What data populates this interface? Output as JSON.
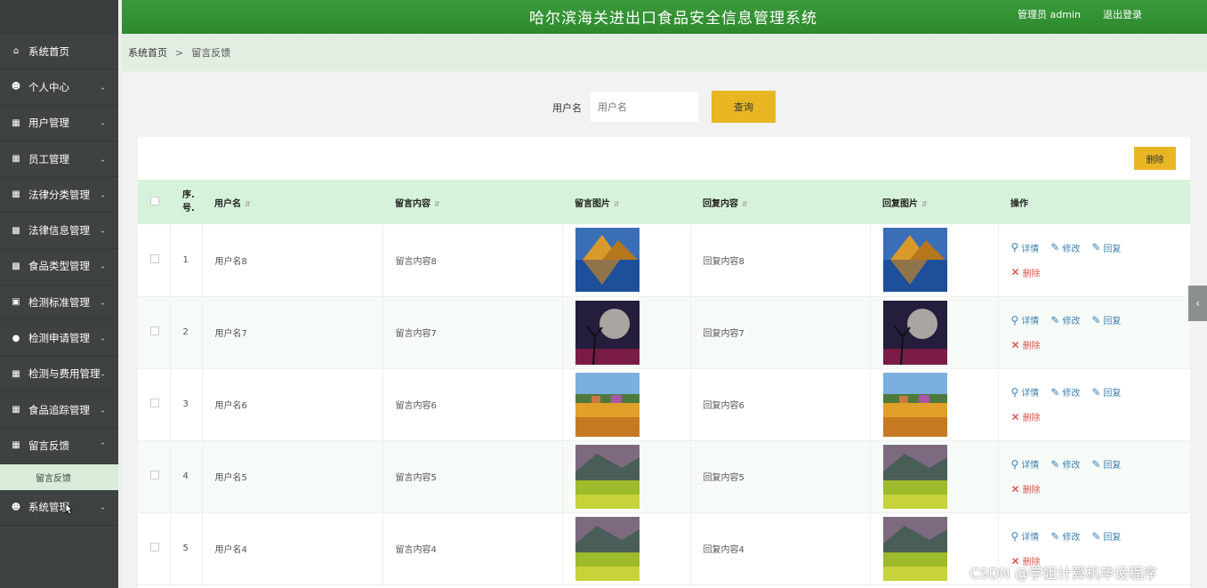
{
  "header": {
    "title": "哈尔滨海关进出口食品安全信息管理系统",
    "user": "管理员 admin",
    "logout": "退出登录"
  },
  "sidebar": {
    "items": [
      {
        "label": "系统首页",
        "icon": "home-icon"
      },
      {
        "label": "个人中心",
        "icon": "person-icon"
      },
      {
        "label": "用户管理",
        "icon": "table-icon"
      },
      {
        "label": "员工管理",
        "icon": "grid-icon"
      },
      {
        "label": "法律分类管理",
        "icon": "grid-icon"
      },
      {
        "label": "法律信息管理",
        "icon": "clipboard-icon"
      },
      {
        "label": "食品类型管理",
        "icon": "clipboard-icon"
      },
      {
        "label": "检测标准管理",
        "icon": "briefcase-icon"
      },
      {
        "label": "检测申请管理",
        "icon": "pin-icon"
      },
      {
        "label": "检测与费用管理",
        "icon": "grid-icon"
      },
      {
        "label": "食品追踪管理",
        "icon": "grid-icon"
      },
      {
        "label": "留言反馈",
        "icon": "grid-icon"
      }
    ],
    "subitem": "留言反馈",
    "last": {
      "label": "系统管理",
      "icon": "person-icon"
    }
  },
  "breadcrumb": {
    "home": "系统首页",
    "sep": ">",
    "current": "留言反馈"
  },
  "search": {
    "label": "用户名",
    "placeholder": "用户名",
    "button": "查询"
  },
  "toolbar": {
    "delete": "删除"
  },
  "table": {
    "headers": {
      "index": "序.号.",
      "username": "用户名",
      "content": "留言内容",
      "image": "留言图片",
      "reply": "回复内容",
      "reply_image": "回复图片",
      "actions": "操作"
    },
    "rows": [
      {
        "index": "1",
        "username": "用户名8",
        "content": "留言内容8",
        "reply": "回复内容8",
        "scene": "lake"
      },
      {
        "index": "2",
        "username": "用户名7",
        "content": "留言内容7",
        "reply": "回复内容7",
        "scene": "moon"
      },
      {
        "index": "3",
        "username": "用户名6",
        "content": "留言内容6",
        "reply": "回复内容6",
        "scene": "field"
      },
      {
        "index": "4",
        "username": "用户名5",
        "content": "留言内容5",
        "reply": "回复内容5",
        "scene": "meadow"
      },
      {
        "index": "5",
        "username": "用户名4",
        "content": "留言内容4",
        "reply": "回复内容4",
        "scene": "meadow"
      }
    ],
    "actions": {
      "detail": "详情",
      "edit": "修改",
      "reply": "回复",
      "delete": "删除"
    }
  },
  "watermark": "CSDN @学姐计算机毕设程序"
}
